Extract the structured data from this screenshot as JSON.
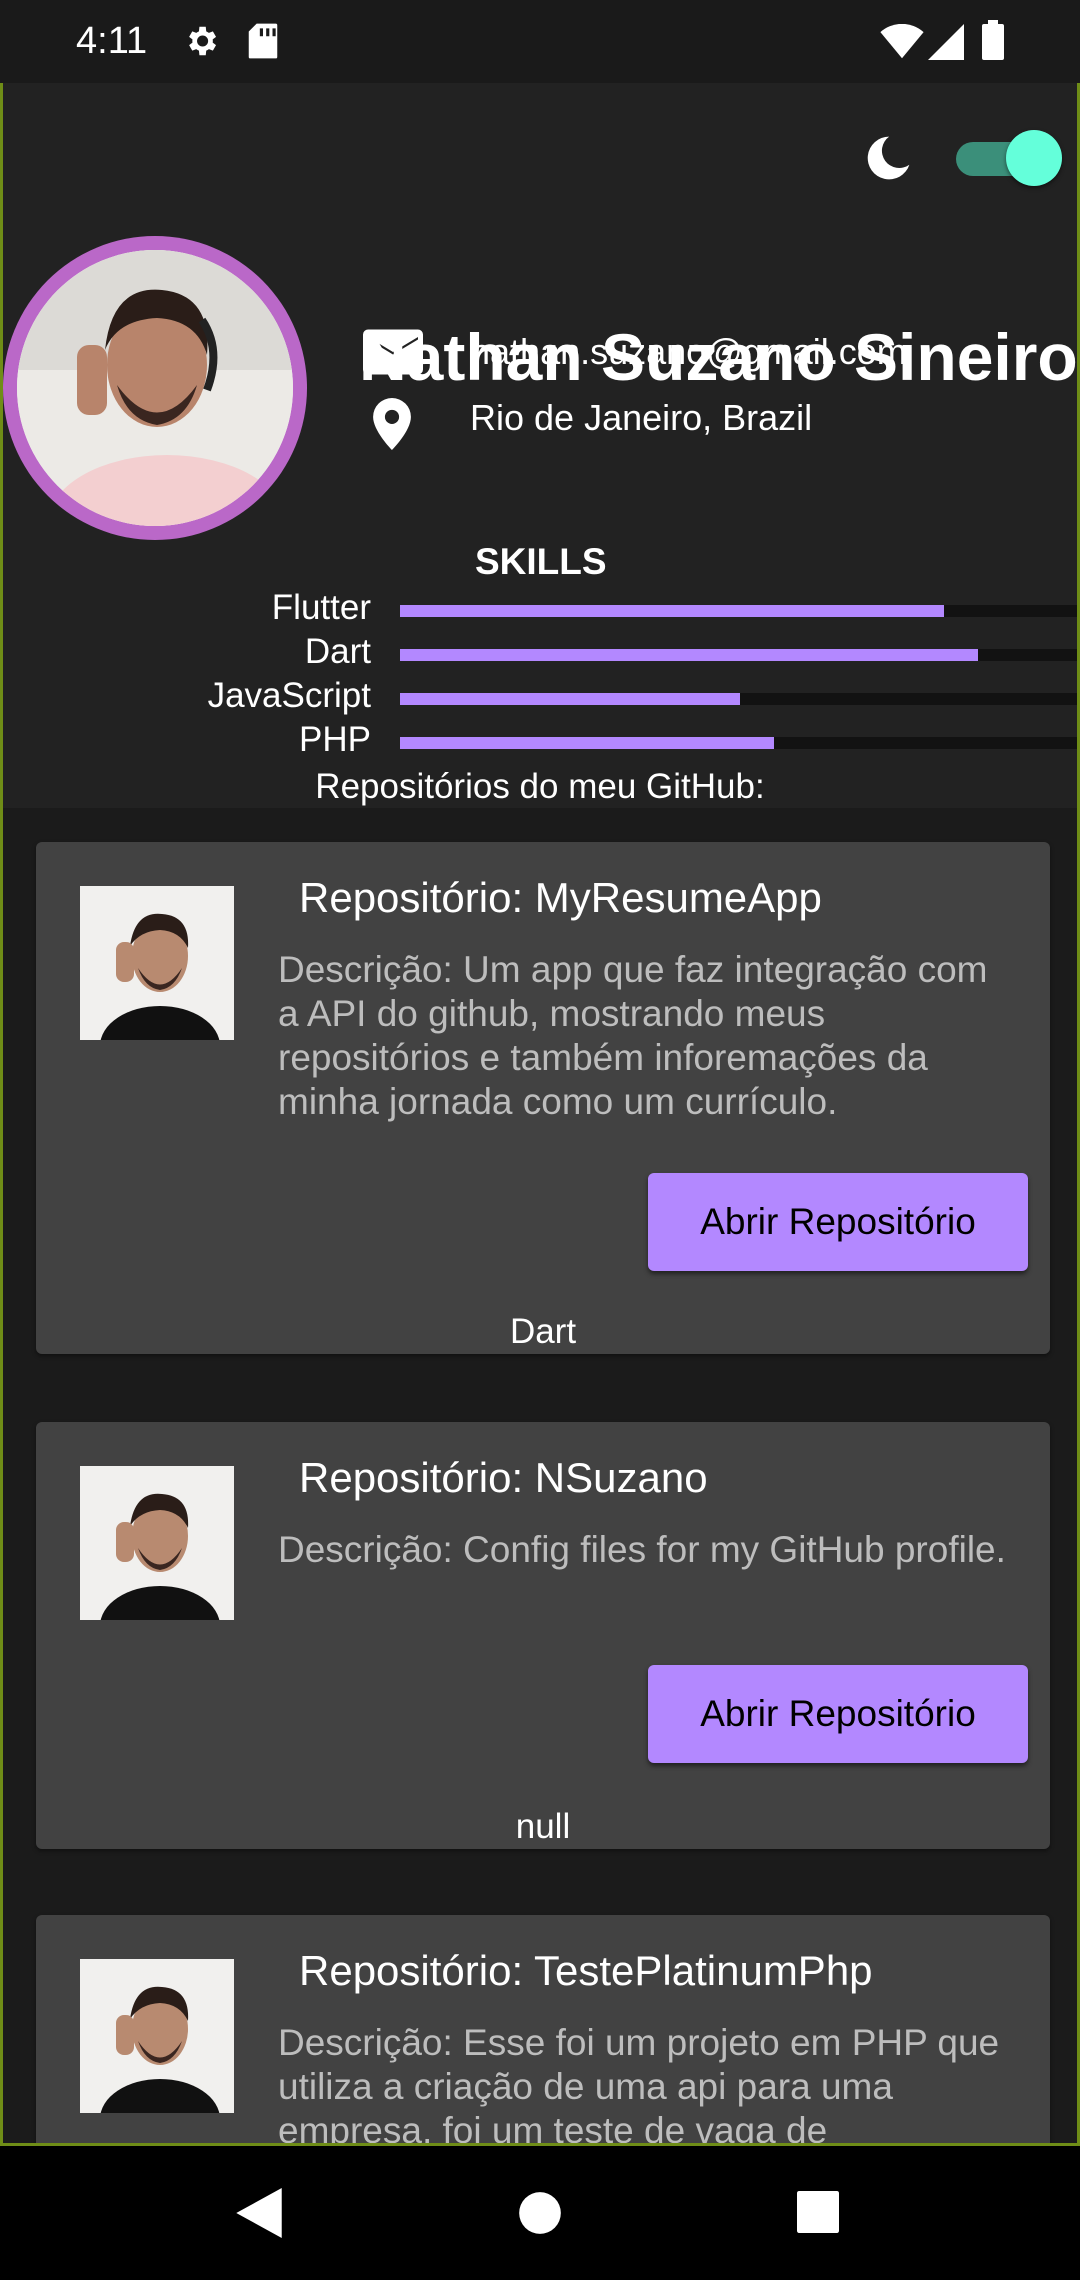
{
  "status_bar": {
    "time": "4:11",
    "icons": [
      "gear-icon",
      "sd-card-icon",
      "wifi-icon",
      "signal-icon",
      "battery-icon"
    ]
  },
  "header": {
    "theme_icon": "moon-icon",
    "dark_mode_enabled": true,
    "name": "Nathan Suzano Sineiro",
    "email": "nathan.suzano@gmail.com",
    "location": "Rio de Janeiro, Brazil"
  },
  "skills": {
    "title": "SKILLS",
    "items": [
      {
        "label": "Flutter",
        "level": 0.8
      },
      {
        "label": "Dart",
        "level": 0.85
      },
      {
        "label": "JavaScript",
        "level": 0.5
      },
      {
        "label": "PHP",
        "level": 0.55
      }
    ]
  },
  "repos": {
    "title": "Repositórios do meu GitHub:",
    "items": [
      {
        "name": "Repositório: MyResumeApp",
        "description": "Descrição: Um app que faz integração com a API do github, mostrando meus repositórios e também inforemações da minha jornada como um currículo.",
        "button": "Abrir Repositório",
        "language": "Dart"
      },
      {
        "name": "Repositório: NSuzano",
        "description": "Descrição: Config files for my GitHub profile.",
        "button": "Abrir Repositório",
        "language": "null"
      },
      {
        "name": "Repositório: TestePlatinumPhp",
        "description": "Descrição: Esse foi um projeto em PHP que utiliza a criação de uma api para uma empresa, foi um teste de vaga de"
      }
    ]
  },
  "colors": {
    "accent": "#b388ff",
    "avatar_ring": "#ba68c8",
    "toggle_thumb": "#64ffda",
    "card": "#424242"
  },
  "nav_bar": {
    "icons": [
      "back-icon",
      "home-icon",
      "recents-icon"
    ]
  }
}
